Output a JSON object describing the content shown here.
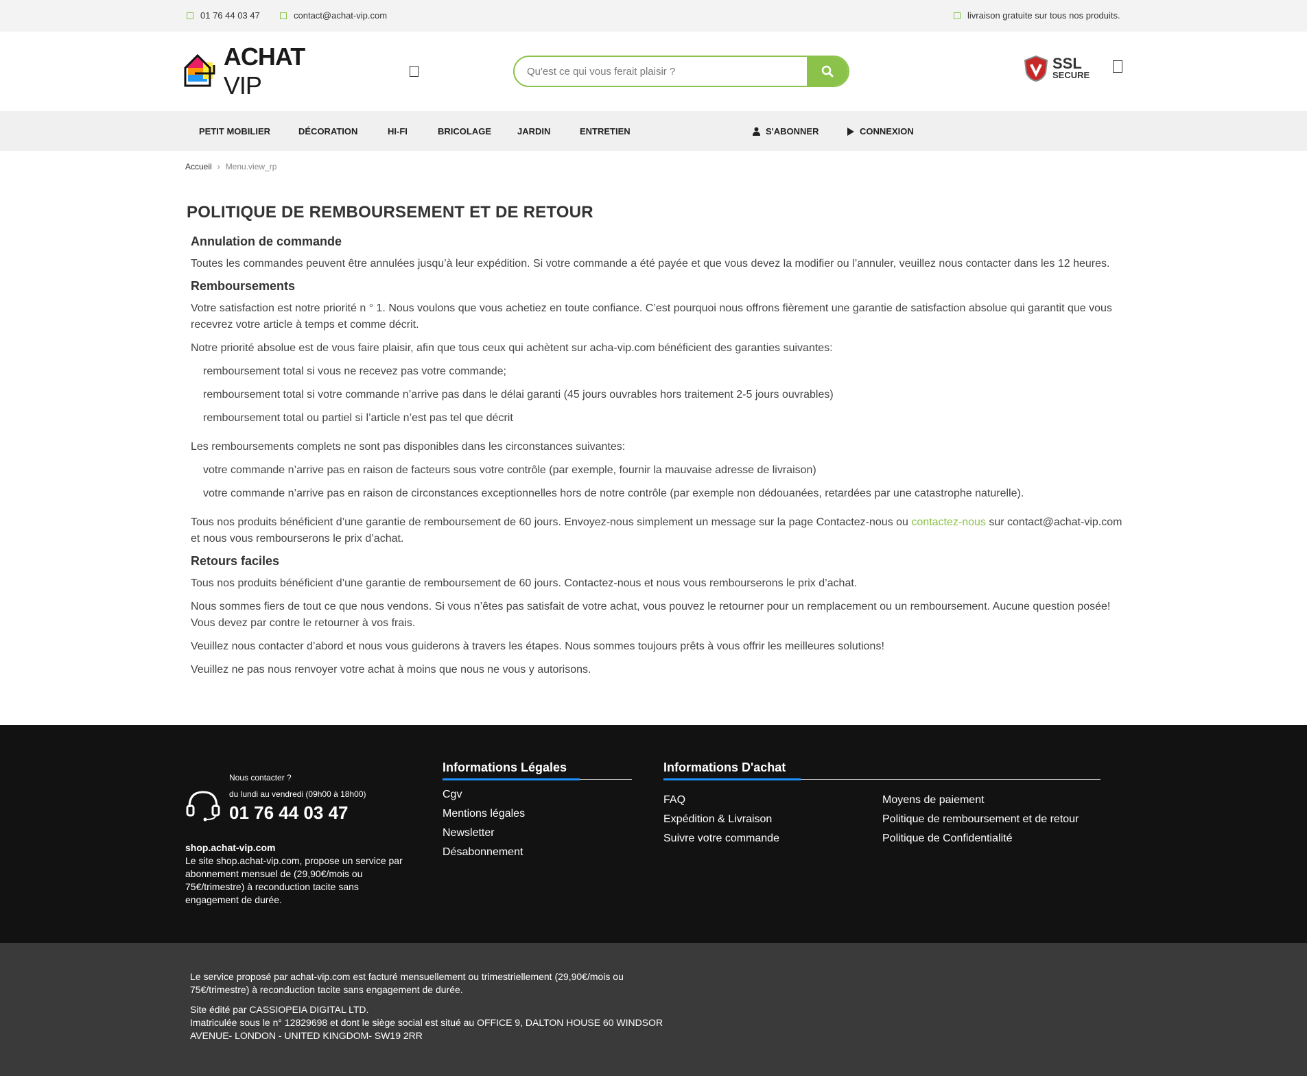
{
  "topbar": {
    "phone": "01 76 44 03 47",
    "email": "contact@achat-vip.com",
    "shipping": "livraison gratuite sur tous nos produits."
  },
  "header": {
    "logo_main": "ACHAT",
    "logo_sub": "VIP",
    "search_placeholder": "Qu'est ce qui vous ferait plaisir ?",
    "ssl_line1": "SSL",
    "ssl_line2": "SECURE"
  },
  "nav": {
    "items": [
      "PETIT MOBILIER",
      "DÉCORATION",
      "HI-FI",
      "BRICOLAGE",
      "JARDIN",
      "ENTRETIEN"
    ],
    "subscribe": "S'ABONNER",
    "login": "CONNEXION"
  },
  "breadcrumb": {
    "home": "Accueil",
    "separator": "›",
    "current": "Menu.view_rp"
  },
  "page": {
    "title": "POLITIQUE DE REMBOURSEMENT ET DE RETOUR",
    "cancel_heading": "Annulation de commande",
    "cancel_text": "Toutes les commandes peuvent être annulées jusqu’à leur expédition. Si votre commande a été payée et que vous devez la modifier ou l’annuler, veuillez nous contacter dans les 12 heures.",
    "refund_heading": "Remboursements",
    "refund_p1": "Votre satisfaction est notre priorité n ° 1. Nous voulons que vous achetiez en toute confiance. C’est pourquoi nous offrons fièrement une garantie de satisfaction absolue qui garantit que vous recevrez votre article à temps et comme décrit.",
    "refund_p2": "Notre priorité absolue est de vous faire plaisir, afin que tous ceux qui achètent sur acha-vip.com bénéficient des garanties suivantes:",
    "guarantees": [
      "remboursement total si vous ne recevez pas votre commande;",
      "remboursement total si votre commande n’arrive pas dans le délai garanti (45 jours ouvrables hors traitement 2-5 jours ouvrables)",
      "remboursement total ou partiel si l’article n’est pas tel que décrit"
    ],
    "exclusions_intro": "Les remboursements complets ne sont pas disponibles dans les circonstances suivantes:",
    "exclusions": [
      "votre commande n’arrive pas en raison de facteurs sous votre contrôle (par exemple, fournir la mauvaise adresse de livraison)",
      "votre commande n’arrive pas en raison de circonstances exceptionnelles hors de notre contrôle (par exemple non dédouanées, retardées par une catastrophe naturelle)."
    ],
    "refund_p3_a": "Tous nos produits bénéficient d’une garantie de remboursement de 60 jours. Envoyez-nous simplement un message sur la page Contactez-nous ou ",
    "refund_p3_link": "contactez-nous",
    "refund_p3_b": " sur contact@achat-vip.com et nous vous rembourserons le prix d’achat.",
    "returns_heading": "Retours faciles",
    "returns_p1": "Tous nos produits bénéficient d’une garantie de remboursement de 60 jours. Contactez-nous et nous vous rembourserons le prix d’achat.",
    "returns_p2": "Nous sommes fiers de tout ce que nous vendons. Si vous n’êtes pas satisfait de votre achat, vous pouvez le retourner pour un remplacement ou un remboursement. Aucune question posée! Vous devez par contre le retourner à vos frais.",
    "returns_p3": "Veuillez nous contacter d’abord et nous vous guiderons à travers les étapes. Nous sommes toujours prêts à vous offrir les meilleures solutions!",
    "returns_p4": "Veuillez ne pas nous renvoyer votre achat à moins que nous ne vous y autorisons."
  },
  "footer": {
    "contact_label": "Nous contacter ?",
    "contact_hours": "du lundi au vendredi (09h00 à 18h00)",
    "contact_phone": "01 76 44 03 47",
    "site_title": "shop.achat-vip.com",
    "site_text": "Le site shop.achat-vip.com, propose un service par abonnement mensuel de (29,90€/mois ou 75€/trimestre) à reconduction tacite sans engagement de durée.",
    "legal_heading": "Informations Légales",
    "legal_links": [
      "Cgv",
      "Mentions légales",
      "Newsletter",
      "Désabonnement"
    ],
    "purchase_heading": "Informations D'achat",
    "purchase_links_col1": [
      "FAQ",
      "Expédition & Livraison",
      "Suivre votre commande"
    ],
    "purchase_links_col2": [
      "Moyens de paiement",
      "Politique de remboursement et de retour",
      "Politique de Confidentialité"
    ]
  },
  "subfooter": {
    "line1": "Le service proposé par achat-vip.com est facturé mensuellement ou trimestriellement (29,90€/mois ou 75€/trimestre) à reconduction tacite sans engagement de durée.",
    "line2": "Site édité par CASSIOPEIA DIGITAL LTD.",
    "line3": "Imatriculée sous le n° 12829698 et dont le siège social est situé au OFFICE 9, DALTON HOUSE 60 WINDSOR AVENUE- LONDON - UNITED KINGDOM- SW19 2RR"
  },
  "colors": {
    "accent": "#8bc34a",
    "footer_bg": "#121212",
    "subfooter_bg": "#3a3a3a",
    "underline": "#1e90ff"
  },
  "icons": [
    "phone-icon",
    "mail-icon",
    "truck-icon",
    "menu-icon",
    "search-icon",
    "ssl-shield-icon",
    "cart-icon",
    "user-icon",
    "play-icon",
    "headset-icon"
  ]
}
